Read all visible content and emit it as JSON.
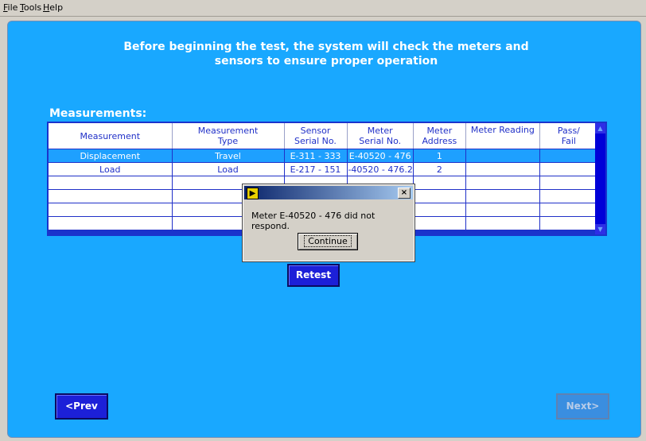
{
  "menu": {
    "file_underline": "F",
    "file_rest": "ile",
    "tools_underline": "T",
    "tools_rest": "ools",
    "help_underline": "H",
    "help_rest": "elp"
  },
  "instruction": {
    "line1": "Before beginning the test, the system will check the meters and",
    "line2": "sensors to ensure proper operation"
  },
  "measurements_label": "Measurements:",
  "table": {
    "headers": {
      "measurement": "Measurement",
      "type_l1": "Measurement",
      "type_l2": "Type",
      "sensor_l1": "Sensor",
      "sensor_l2": "Serial No.",
      "meter_l1": "Meter",
      "meter_l2": "Serial No.",
      "addr_l1": "Meter",
      "addr_l2": "Address",
      "reading": "Meter Reading",
      "pass_l1": "Pass/",
      "pass_l2": "Fail"
    },
    "rows": [
      {
        "measurement": "Displacement",
        "type": "Travel",
        "sensor": "E-311 - 333",
        "meter": "E-40520 - 476",
        "address": "1",
        "reading": "",
        "pass": ""
      },
      {
        "measurement": "Load",
        "type": "Load",
        "sensor": "E-217 - 151",
        "meter": "E-40520 - 476.2",
        "address": "2",
        "reading": "",
        "pass": ""
      }
    ]
  },
  "buttons": {
    "retest": "Retest",
    "prev": "<Prev",
    "next": "Next>"
  },
  "dialog": {
    "message": "Meter E-40520 - 476 did not respond.",
    "button": "Continue",
    "close": "×"
  },
  "colors": {
    "panel": "#19a8ff",
    "button": "#1c20d8",
    "selected_row": "#1ea0ff"
  }
}
